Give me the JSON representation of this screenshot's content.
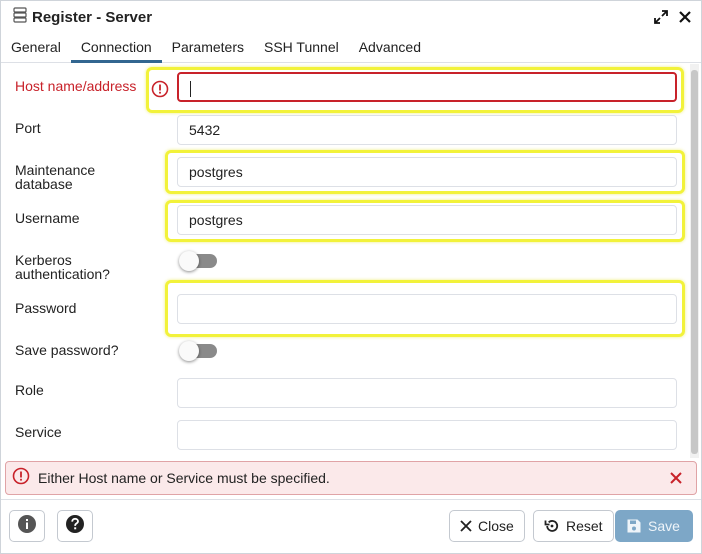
{
  "window": {
    "title": "Register - Server"
  },
  "tabs": [
    {
      "label": "General",
      "active": false
    },
    {
      "label": "Connection",
      "active": true
    },
    {
      "label": "Parameters",
      "active": false
    },
    {
      "label": "SSH Tunnel",
      "active": false
    },
    {
      "label": "Advanced",
      "active": false
    }
  ],
  "fields": {
    "host": {
      "label": "Host name/address",
      "value": "",
      "state": "error"
    },
    "port": {
      "label": "Port",
      "value": "5432"
    },
    "maintenance_db": {
      "label_line1": "Maintenance",
      "label_line2": "database",
      "value": "postgres"
    },
    "username": {
      "label": "Username",
      "value": "postgres"
    },
    "kerberos": {
      "label_line1": "Kerberos",
      "label_line2": "authentication?",
      "on": false
    },
    "password": {
      "label": "Password",
      "value": ""
    },
    "save_password": {
      "label": "Save password?",
      "on": false
    },
    "role": {
      "label": "Role",
      "value": ""
    },
    "service": {
      "label": "Service",
      "value": ""
    }
  },
  "error_bar": {
    "message": "Either Host name or Service must be specified."
  },
  "footer": {
    "close_label": "Close",
    "reset_label": "Reset",
    "save_label": "Save"
  },
  "colors": {
    "accent": "#326690",
    "error": "#c8222a",
    "highlight": "#f2f23a",
    "save_disabled": "#7da7c7"
  }
}
